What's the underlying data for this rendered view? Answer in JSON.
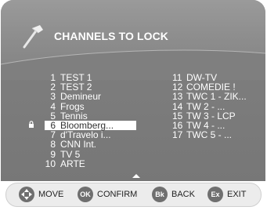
{
  "header": {
    "title": "CHANNELS TO LOCK"
  },
  "channels_left": [
    {
      "num": "1",
      "name": "TEST 1"
    },
    {
      "num": "2",
      "name": "TEST 2"
    },
    {
      "num": "3",
      "name": "Demineur"
    },
    {
      "num": "4",
      "name": "Frogs"
    },
    {
      "num": "5",
      "name": "Tennis"
    },
    {
      "num": "6",
      "name": "Bloomberg..."
    },
    {
      "num": "7",
      "name": "d'Travelo  i..."
    },
    {
      "num": "8",
      "name": "CNN Int."
    },
    {
      "num": "9",
      "name": "TV 5"
    },
    {
      "num": "10",
      "name": "ARTE"
    }
  ],
  "channels_right": [
    {
      "num": "11",
      "name": "DW-TV"
    },
    {
      "num": "12",
      "name": "COMEDIE !"
    },
    {
      "num": "13",
      "name": "TWC 1 - ZIK..."
    },
    {
      "num": "14",
      "name": "TW 2 - ..."
    },
    {
      "num": "15",
      "name": "TW 3 - LCP"
    },
    {
      "num": "16",
      "name": "TW 4 - ..."
    },
    {
      "num": "17",
      "name": "TWC 5 - ..."
    }
  ],
  "selected_channel": "6",
  "footer": {
    "move": {
      "key": "",
      "label": "MOVE"
    },
    "confirm": {
      "key": "OK",
      "label": "CONFIRM"
    },
    "back": {
      "key": "Bk",
      "label": "BACK"
    },
    "exit": {
      "key": "Ex",
      "label": "EXIT"
    }
  },
  "colors": {
    "panel": "#8a8a8a",
    "text": "#ffffff",
    "selection": "#ffffff",
    "footer": "#ececec",
    "key": "#6f6f6f"
  },
  "icons": [
    "hammer-icon",
    "lock-icon",
    "up-arrow-icon",
    "navigation-pad-icon"
  ]
}
